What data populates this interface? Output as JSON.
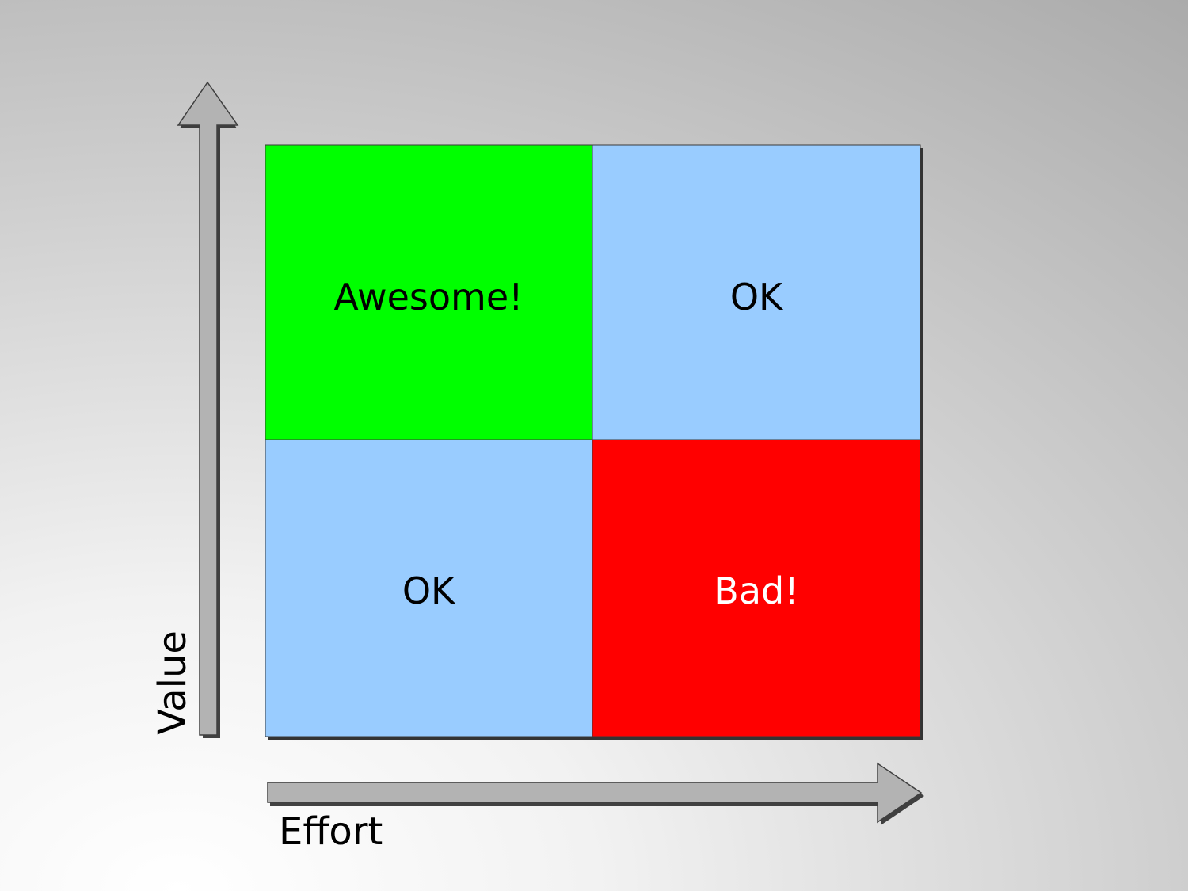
{
  "axes": {
    "y_label": "Value",
    "x_label": "Effort"
  },
  "quadrants": [
    {
      "id": "top-left",
      "label": "Awesome!",
      "fill": "#00ff00",
      "text_color": "#000000"
    },
    {
      "id": "top-right",
      "label": "OK",
      "fill": "#99ccff",
      "text_color": "#000000"
    },
    {
      "id": "bottom-left",
      "label": "OK",
      "fill": "#99ccff",
      "text_color": "#000000"
    },
    {
      "id": "bottom-right",
      "label": "Bad!",
      "fill": "#ff0000",
      "text_color": "#ffffff"
    }
  ],
  "colors": {
    "arrow_fill": "#b3b3b3",
    "arrow_stroke": "#3f3f3f",
    "shadow": "#333333"
  }
}
